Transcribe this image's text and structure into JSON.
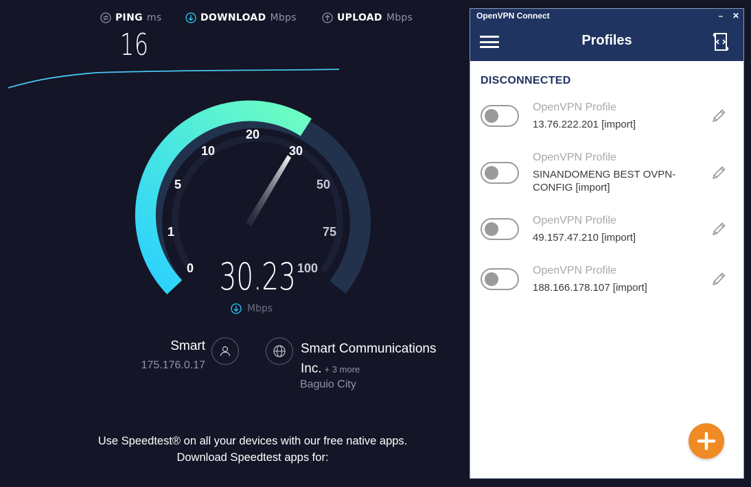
{
  "speedtest": {
    "ping": {
      "label": "PING",
      "unit": "ms",
      "value": "16",
      "icon": "ping-icon"
    },
    "download": {
      "label": "DOWNLOAD",
      "unit": "Mbps",
      "icon": "download-arrow-icon"
    },
    "upload": {
      "label": "UPLOAD",
      "unit": "Mbps",
      "icon": "upload-arrow-icon"
    },
    "gauge": {
      "labels": [
        "0",
        "1",
        "5",
        "10",
        "20",
        "30",
        "50",
        "75",
        "100"
      ],
      "current_speed": "30.23",
      "unit": "Mbps",
      "fill_fraction": 0.625,
      "colors": {
        "fill_start": "#2ad0ff",
        "fill_end": "#6effc0",
        "track": "#22324d",
        "needle": "#ffffff"
      }
    },
    "isp": {
      "name": "Smart",
      "ip": "175.176.0.17",
      "icon": "user-icon"
    },
    "server": {
      "name": "Smart Communications Inc.",
      "more": "+ 3 more",
      "city": "Baguio City",
      "icon": "globe-icon"
    },
    "promo": {
      "line1": "Use Speedtest® on all your devices with our free native apps.",
      "line2": "Download Speedtest apps for:"
    }
  },
  "openvpn": {
    "window_title": "OpenVPN Connect",
    "minimize": "–",
    "close": "✕",
    "header_title": "Profiles",
    "status": "DISCONNECTED",
    "colors": {
      "header": "#1f3461",
      "fab": "#f08a24"
    },
    "profiles": [
      {
        "name": "OpenVPN Profile",
        "subtitle": "13.76.222.201 [import]",
        "connected": false
      },
      {
        "name": "OpenVPN Profile",
        "subtitle": "SINANDOMENG BEST OVPN-CONFIG [import]",
        "connected": false
      },
      {
        "name": "OpenVPN Profile",
        "subtitle": "49.157.47.210 [import]",
        "connected": false
      },
      {
        "name": "OpenVPN Profile",
        "subtitle": "188.166.178.107 [import]",
        "connected": false
      }
    ]
  }
}
